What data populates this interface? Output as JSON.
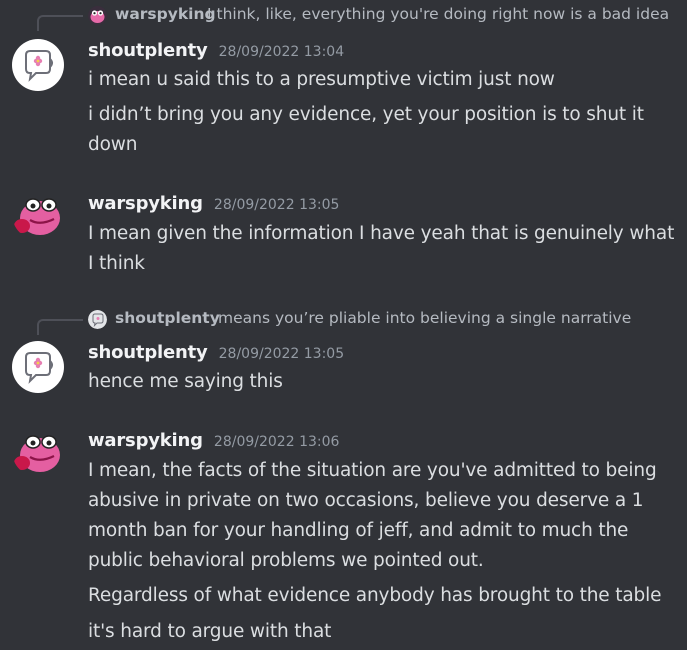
{
  "messages": [
    {
      "reply": {
        "author": "warspyking",
        "text": "I think, like, everything you're doing right now is a bad idea"
      },
      "author": "shoutplenty",
      "timestamp": "28/09/2022 13:04",
      "lines": [
        "i mean u said this to a presumptive victim just now",
        "i didn’t bring you any evidence, yet your position is to shut it down"
      ]
    },
    {
      "author": "warspyking",
      "timestamp": "28/09/2022 13:05",
      "lines": [
        "I mean given the information I have yeah that is genuinely what I think"
      ]
    },
    {
      "reply": {
        "author": "shoutplenty",
        "text": "means you’re pliable into believing a single narrative"
      },
      "author": "shoutplenty",
      "timestamp": "28/09/2022 13:05",
      "lines": [
        "hence me saying this"
      ]
    },
    {
      "author": "warspyking",
      "timestamp": "28/09/2022 13:06",
      "lines": [
        "I mean, the facts of the situation are you've admitted to being abusive in private on two occasions, believe you deserve a 1 month ban for your handling of jeff, and admit to much the public behavioral problems we pointed out.",
        "Regardless of what evidence anybody has brought to the table",
        "it's hard to argue with that"
      ]
    }
  ],
  "colors": {
    "background": "#313338",
    "username": "#f2f3f5",
    "timestamp": "#949ba4",
    "text": "#dbdee1",
    "reply_text": "#b5bac1"
  }
}
